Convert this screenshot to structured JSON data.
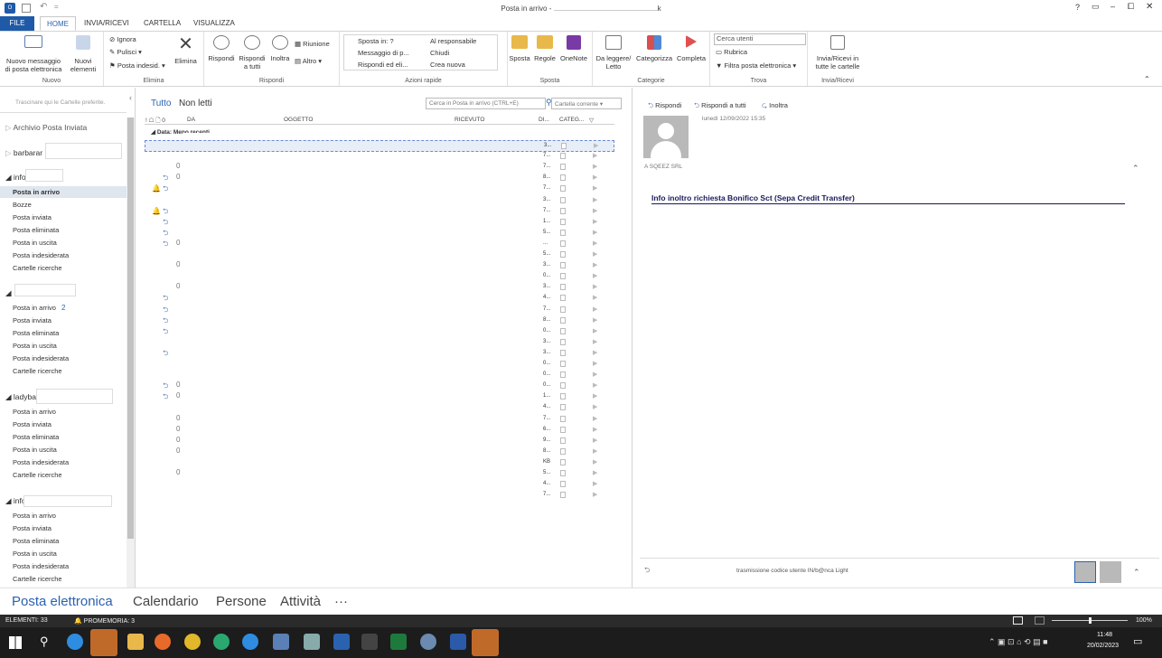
{
  "window": {
    "title": "Posta in arrivo - ",
    "title_suffix": "k",
    "help": "?",
    "controls": [
      "▭",
      "–",
      "⧠",
      "✕"
    ]
  },
  "tabs": {
    "file": "FILE",
    "home": "HOME",
    "send": "INVIA/RICEVI",
    "folder": "CARTELLA",
    "view": "VISUALIZZA"
  },
  "ribbon": {
    "nuovo": {
      "new_mail": "Nuovo messaggio\ndi posta elettronica",
      "new_items": "Nuovi\nelementi",
      "group": "Nuovo"
    },
    "elimina": {
      "ignora": "Ignora",
      "pulisci": "Pulisci",
      "indesid": "Posta indesid.",
      "elimina": "Elimina",
      "group": "Elimina"
    },
    "rispondi": {
      "rispondi": "Rispondi",
      "rispondi_tutti": "Rispondi\na tutti",
      "inoltra": "Inoltra",
      "riunione": "Riunione",
      "altro": "Altro",
      "group": "Rispondi"
    },
    "azioni": {
      "items": [
        "Sposta in: ?",
        "Messaggio di p...",
        "Rispondi ed eli...",
        "Al responsabile",
        "Chiudi",
        "Crea nuova"
      ],
      "group": "Azioni rapide"
    },
    "sposta": {
      "sposta": "Sposta",
      "regole": "Regole",
      "onenote": "OneNote",
      "group": "Sposta"
    },
    "categorie": {
      "da_leggere": "Da leggere/\nLetto",
      "categorizza": "Categorizza",
      "completa": "Completa",
      "group": "Categorie"
    },
    "trova": {
      "search": "Cerca utenti",
      "rubrica": "Rubrica",
      "filtra": "Filtra posta elettronica",
      "group": "Trova"
    },
    "invia": {
      "invia": "Invia/Ricevi in\ntutte le cartelle",
      "group": "Invia/Ricevi"
    }
  },
  "sidebar": {
    "favorites_hint": "Trascinare qui le Cartelle preferite.",
    "archivio": "Archivio Posta Inviata",
    "acct1": "barbarar",
    "acct2": "info",
    "acct2_folders": [
      "Posta in arrivo",
      "Bozze",
      "Posta inviata",
      "Posta eliminata",
      "Posta in uscita",
      "Posta indesiderata",
      "Cartelle ricerche"
    ],
    "acct3": "",
    "acct3_folders": [
      "Posta in arrivo",
      "Posta inviata",
      "Posta eliminata",
      "Posta in uscita",
      "Posta indesiderata",
      "Cartelle ricerche"
    ],
    "acct3_count": "2",
    "acct4": "ladyba",
    "acct4_folders": [
      "Posta in arrivo",
      "Posta inviata",
      "Posta eliminata",
      "Posta in uscita",
      "Posta indesiderata",
      "Cartelle ricerche"
    ],
    "acct5": "info",
    "acct5_folders": [
      "Posta in arrivo",
      "Posta inviata",
      "Posta eliminata",
      "Posta in uscita",
      "Posta indesiderata",
      "Cartelle ricerche"
    ]
  },
  "list": {
    "filter_all": "Tutto",
    "filter_unread": "Non letti",
    "search_placeholder": "Cerca in Posta in arrivo (CTRL+E)",
    "scope": "Cartella corrente",
    "cols": {
      "icons": "! ☖ 🗋 0",
      "from": "DA",
      "subject": "OGGETTO",
      "received": "RICEVUTO",
      "size": "DI...",
      "cat": "CATEG..."
    },
    "group": "Data: Meno recenti",
    "rows": [
      {
        "d": "3...",
        "c": 0,
        "r": 0,
        "b": 0
      },
      {
        "d": "7...",
        "c": 0,
        "r": 0,
        "b": 0
      },
      {
        "d": "7...",
        "c": 1,
        "r": 0,
        "b": 0
      },
      {
        "d": "8...",
        "c": 1,
        "r": 1,
        "b": 0
      },
      {
        "d": "7...",
        "c": 0,
        "r": 1,
        "b": 1
      },
      {
        "d": "3...",
        "c": 0,
        "r": 0,
        "b": 0
      },
      {
        "d": "7...",
        "c": 0,
        "r": 1,
        "b": 1
      },
      {
        "d": "1...",
        "c": 0,
        "r": 1,
        "b": 0
      },
      {
        "d": "5...",
        "c": 0,
        "r": 1,
        "b": 0
      },
      {
        "d": "...",
        "c": 1,
        "r": 1,
        "b": 0
      },
      {
        "d": "5...",
        "c": 0,
        "r": 0,
        "b": 0
      },
      {
        "d": "3...",
        "c": 1,
        "r": 0,
        "b": 0
      },
      {
        "d": "0...",
        "c": 0,
        "r": 0,
        "b": 0
      },
      {
        "d": "3...",
        "c": 1,
        "r": 0,
        "b": 0
      },
      {
        "d": "4...",
        "c": 0,
        "r": 1,
        "b": 0
      },
      {
        "d": "7...",
        "c": 0,
        "r": 1,
        "b": 0
      },
      {
        "d": "8...",
        "c": 0,
        "r": 1,
        "b": 0
      },
      {
        "d": "0...",
        "c": 0,
        "r": 1,
        "b": 0
      },
      {
        "d": "3...",
        "c": 0,
        "r": 0,
        "b": 0
      },
      {
        "d": "3...",
        "c": 0,
        "r": 1,
        "b": 0
      },
      {
        "d": "0...",
        "c": 0,
        "r": 0,
        "b": 0
      },
      {
        "d": "0...",
        "c": 0,
        "r": 0,
        "b": 0
      },
      {
        "d": "0...",
        "c": 1,
        "r": 1,
        "b": 0
      },
      {
        "d": "1...",
        "c": 1,
        "r": 1,
        "b": 0
      },
      {
        "d": "4...",
        "c": 0,
        "r": 0,
        "b": 0
      },
      {
        "d": "7...",
        "c": 1,
        "r": 0,
        "b": 0
      },
      {
        "d": "6...",
        "c": 1,
        "r": 0,
        "b": 0
      },
      {
        "d": "9...",
        "c": 1,
        "r": 0,
        "b": 0
      },
      {
        "d": "8...",
        "c": 1,
        "r": 0,
        "b": 0
      },
      {
        "d": "KB",
        "c": 0,
        "r": 0,
        "b": 0
      },
      {
        "d": "5...",
        "c": 1,
        "r": 0,
        "b": 0
      },
      {
        "d": "4...",
        "c": 0,
        "r": 0,
        "b": 0
      },
      {
        "d": "7...",
        "c": 0,
        "r": 0,
        "b": 0
      }
    ]
  },
  "reading": {
    "reply": "Rispondi",
    "reply_all": "Rispondi a tutti",
    "forward": "Inoltra",
    "date": "lunedì 12/09/2022 15:35",
    "sender": "A  SQEEZ SRL",
    "subject": "Info inoltro richiesta Bonifico Sct (Sepa Credit Transfer)",
    "footer_text": "trasmissione codice utente IN/b@nca Light"
  },
  "nav": {
    "mail": "Posta elettronica",
    "calendar": "Calendario",
    "people": "Persone",
    "tasks": "Attività",
    "more": "···"
  },
  "status": {
    "items": "ELEMENTI: 33",
    "reminder": "PROMEMORIA: 3",
    "zoom": "100%"
  },
  "taskbar": {
    "time": "11:48",
    "date": "20/02/2023"
  },
  "colors": {
    "accent": "#2a62b0",
    "file_tab": "#1e5aa8"
  }
}
